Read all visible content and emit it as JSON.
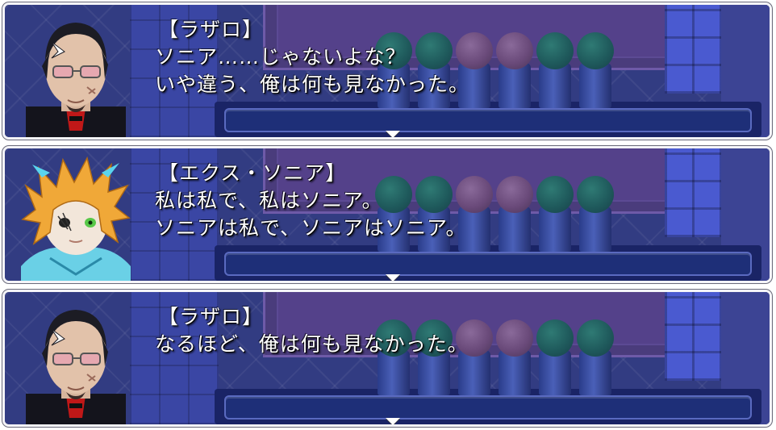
{
  "dialogs": [
    {
      "speaker": "【ラザロ】",
      "lines": [
        "ソニア……じゃないよな？",
        "いや違う、俺は何も見なかった。"
      ],
      "portrait_icon": "lazaro-portrait-icon"
    },
    {
      "speaker": "【エクス・ソニア】",
      "lines": [
        "私は私で、私はソニア。",
        "ソニアは私で、ソニアはソニア。"
      ],
      "portrait_icon": "ex-sonia-portrait-icon"
    },
    {
      "speaker": "【ラザロ】",
      "lines": [
        "なるほど、俺は何も見なかった。"
      ],
      "portrait_icon": "lazaro-portrait-icon"
    }
  ],
  "colors": {
    "text": "#ffffff",
    "panel_border": "#f4f4f8",
    "scene_floor": "#323c82",
    "carpet": "#4a3c7c"
  },
  "cursor_icon": "advance-arrow-icon"
}
